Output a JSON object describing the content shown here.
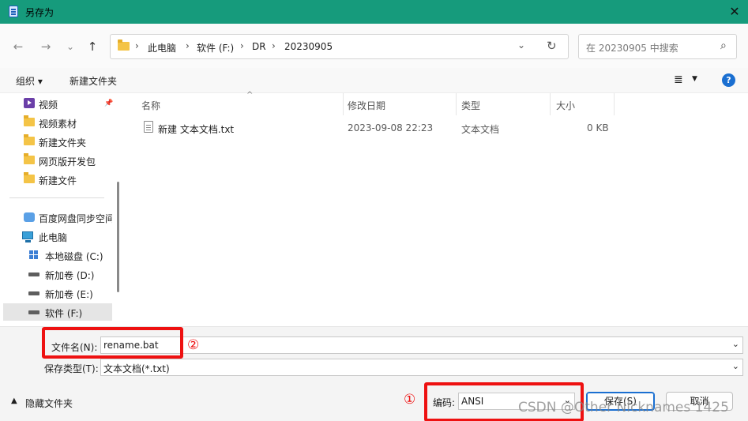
{
  "titlebar": {
    "title": "另存为",
    "close": "✕"
  },
  "nav": {
    "back": "←",
    "forward": "→",
    "recent": "⌄",
    "up": "↑",
    "breadcrumb": [
      "此电脑",
      "软件 (F:)",
      "DR",
      "20230905"
    ],
    "separator": "›",
    "dropdown": "⌄",
    "refresh": "↻",
    "search_placeholder": "在 20230905 中搜索",
    "search_icon": "⌕"
  },
  "toolbar": {
    "organize": "组织 ▾",
    "new_folder": "新建文件夹",
    "view_icon": "≣",
    "view_dd": "▼",
    "help": "?"
  },
  "sidebar": {
    "items": [
      {
        "label": "视频",
        "icon": "video-icon",
        "pinned": true
      },
      {
        "label": "视频素材",
        "icon": "folder-icon"
      },
      {
        "label": "新建文件夹",
        "icon": "folder-icon"
      },
      {
        "label": "网页版开发包",
        "icon": "folder-icon"
      },
      {
        "label": "新建文件",
        "icon": "folder-icon"
      },
      {
        "label": "百度网盘同步空间",
        "icon": "cloud-icon"
      },
      {
        "label": "此电脑",
        "icon": "pc-icon"
      },
      {
        "label": "本地磁盘 (C:)",
        "icon": "windows-drive-icon"
      },
      {
        "label": "新加卷 (D:)",
        "icon": "drive-icon"
      },
      {
        "label": "新加卷 (E:)",
        "icon": "drive-icon"
      },
      {
        "label": "软件 (F:)",
        "icon": "drive-icon",
        "selected": true
      }
    ],
    "pin": "📌"
  },
  "filelist": {
    "columns": [
      "名称",
      "修改日期",
      "类型",
      "大小"
    ],
    "sort_arrow": "^",
    "rows": [
      {
        "name": "新建 文本文档.txt",
        "modified": "2023-09-08 22:23",
        "type": "文本文档",
        "size": "0 KB"
      }
    ]
  },
  "form": {
    "filename_label": "文件名(N):",
    "filename_value": "rename.bat",
    "filetype_label": "保存类型(T):",
    "filetype_value": "文本文档(*.txt)",
    "hide_folders": "隐藏文件夹",
    "hide_arrow": "▲",
    "encoding_label": "编码:",
    "encoding_value": "ANSI",
    "save": "保存(S)",
    "cancel": "取消",
    "chevron": "⌄"
  },
  "annotations": {
    "one": "①",
    "two": "②"
  },
  "watermark": "CSDN @Other Nicknames 1425",
  "colors": {
    "titlebar": "#169b7c",
    "annotation": "#ee1111",
    "accent": "#1a6fd1"
  }
}
